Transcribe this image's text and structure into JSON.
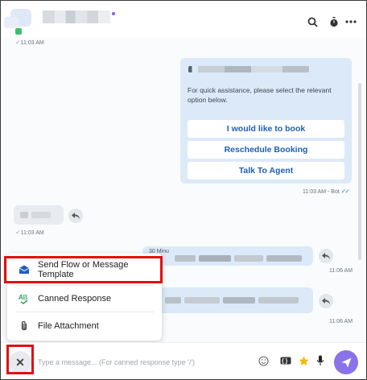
{
  "header": {
    "icons": [
      "search-icon",
      "timer-icon",
      "more-options-icon"
    ]
  },
  "messages": {
    "first_time": "11:03 AM",
    "bot_card": {
      "prompt": "For quick assistance, please select the relevant option below.",
      "options": [
        "I would like to book",
        "Reschedule Booking",
        "Talk To Agent"
      ],
      "time": "11:03 AM - Bot"
    },
    "incoming_time": "11:03 AM",
    "outgoing_1": {
      "prefix": "30 Minu",
      "time": "11:06 AM"
    },
    "outgoing_2": {
      "time": "11:06 AM"
    }
  },
  "attach_menu": {
    "items": [
      {
        "label": "Send Flow or Message Template",
        "icon": "template-message-icon"
      },
      {
        "label": "Canned Response",
        "icon": "canned-response-icon"
      },
      {
        "label": "File Attachment",
        "icon": "paperclip-icon"
      }
    ]
  },
  "composer": {
    "placeholder": "Type a message... (For canned response type '/')",
    "icons": [
      "close-icon",
      "emoji-icon",
      "variable-icon",
      "star-icon",
      "microphone-icon",
      "send-icon"
    ]
  },
  "colors": {
    "accent": "#8a73e8",
    "link_blue": "#1d5fb3",
    "bot_bubble": "#dce9f8",
    "highlight": "#e01010"
  }
}
